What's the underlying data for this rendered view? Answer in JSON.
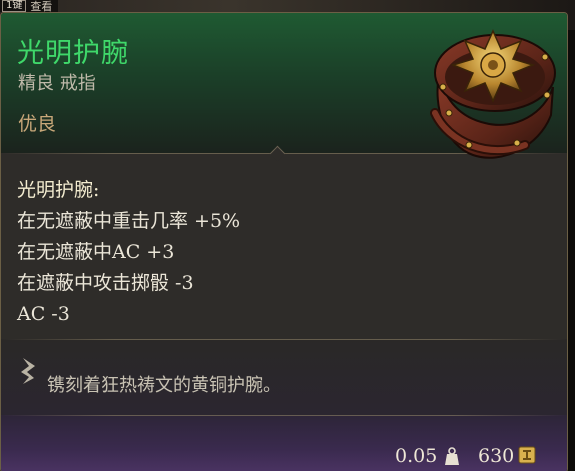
{
  "keyhint": {
    "key": "1键",
    "label": "查看"
  },
  "tooltip": {
    "name": "光明护腕",
    "type": "精良 戒指",
    "rarity": "优良",
    "effect_title": "光明护腕:",
    "effects": [
      "在无遮蔽中重击几率 +5%",
      "在无遮蔽中AC +3",
      "在遮蔽中攻击掷骰 -3",
      "AC -3"
    ],
    "flavor": "镌刻着狂热祷文的黄铜护腕。",
    "weight": "0.05",
    "value": "630"
  },
  "icons": {
    "flavor": "quill-icon",
    "weight": "weight-icon",
    "value": "gold-coin-icon",
    "item": "bracer-item-art"
  },
  "colors": {
    "name": "#3fd86a",
    "rarity": "#c8a779",
    "header": "#1f5a32",
    "footer": "#3a2a4e"
  }
}
